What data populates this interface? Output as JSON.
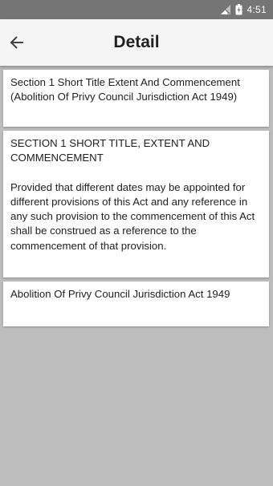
{
  "status_bar": {
    "time": "4:51",
    "icons": [
      "signal-icon",
      "battery-icon"
    ]
  },
  "app_bar": {
    "title": "Detail",
    "back_icon": "arrow-left-icon"
  },
  "cards": [
    {
      "text": "Section 1 Short Title Extent And Commencement (Abolition Of Privy Council Jurisdiction Act 1949)"
    },
    {
      "heading": "SECTION 1 SHORT TITLE, EXTENT AND COMMENCEMENT",
      "body": "Provided that different dates may be appointed for different provisions of this Act and any reference in any such provision to the commencement of this Act shall be construed as a reference to the commencement of that provision."
    },
    {
      "text": "Abolition Of Privy Council Jurisdiction Act 1949"
    }
  ],
  "colors": {
    "status_bar_bg": "#757575",
    "app_bar_bg": "#f5f5f5",
    "page_bg": "#bdbdbd",
    "card_bg": "#ffffff",
    "text": "#212121"
  }
}
